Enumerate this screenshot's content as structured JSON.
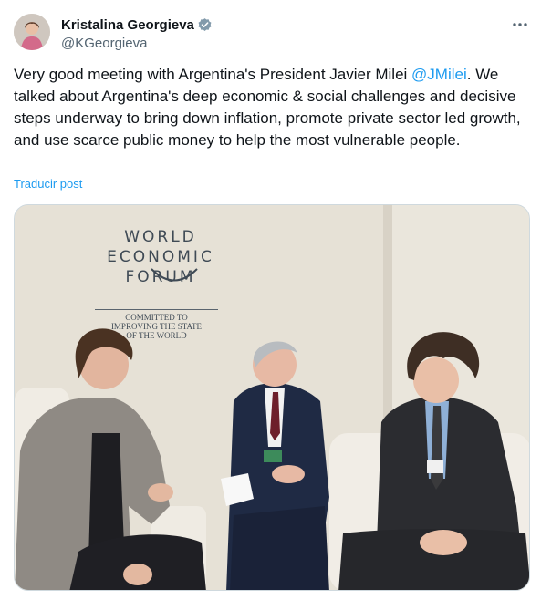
{
  "author": {
    "display_name": "Kristalina Georgieva",
    "handle": "@KGeorgieva",
    "verified_icon": "verified-badge-icon"
  },
  "tweet": {
    "text_before": "Very good meeting with Argentina's President Javier Milei ",
    "mention": "@JMilei",
    "text_after": ". We talked about Argentina's deep economic & social challenges and decisive steps underway to bring down inflation, promote private sector led growth, and use scarce public money to help the most vulnerable people.",
    "translate_label": "Traducir post"
  },
  "photo": {
    "wef_line1": "WORLD",
    "wef_line2": "ECONOMIC",
    "wef_line3": "FORUM",
    "tag_line1": "COMMITTED TO",
    "tag_line2": "IMPROVING THE STATE",
    "tag_line3": "OF THE WORLD"
  },
  "colors": {
    "link": "#1d9bf0",
    "text": "#0f1419",
    "secondary": "#536471"
  }
}
